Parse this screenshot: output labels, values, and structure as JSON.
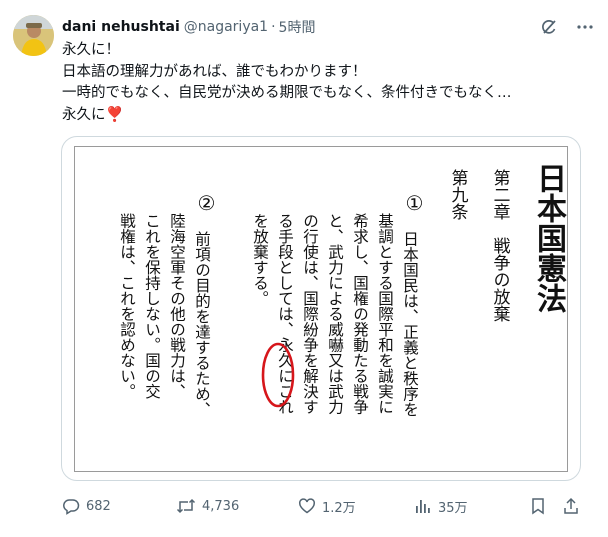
{
  "author": {
    "name": "dani nehushtai",
    "handle": "@nagariya1",
    "separator": "·",
    "time": "5時間"
  },
  "post_text": {
    "line1": "永久に！",
    "line2": "日本語の理解力があれば、誰でもわかります！",
    "line3": "一時的でもなく、自民党が決める期限でもなく、条件付きでもなく…",
    "line4": "永久に",
    "heart": "❣️"
  },
  "image_text": {
    "title": "日本国憲法",
    "chapter": "第二章　戦争の放棄",
    "article": "第九条",
    "para1_num": "①",
    "para1_col1": "日本国民は、正義と秩序を",
    "para1_col2": "基調とする国際平和を誠実に",
    "para1_col3": "希求し、国権の発動たる戦争",
    "para1_col4": "と、武力による威嚇又は武力",
    "para1_col5": "の行使は、国際紛争を解決す",
    "para1_col6": "る手段としては、永久にこれ",
    "para1_col7": "を放棄する。",
    "para2_num": "②",
    "para2_col1": "前項の目的を達するため、",
    "para2_col2": "陸海空軍その他の戦力は、",
    "para2_col3": "これを保持しない。国の交",
    "para2_col4": "戦権は、これを認めない。",
    "highlight_color": "#d6161b"
  },
  "actions": {
    "replies": "682",
    "reposts": "4,736",
    "likes": "1.2万",
    "views": "35万"
  },
  "icons": [
    "avatar",
    "grok-icon",
    "more-icon",
    "reply-icon",
    "repost-icon",
    "like-icon",
    "views-icon",
    "bookmark-icon",
    "share-icon"
  ]
}
